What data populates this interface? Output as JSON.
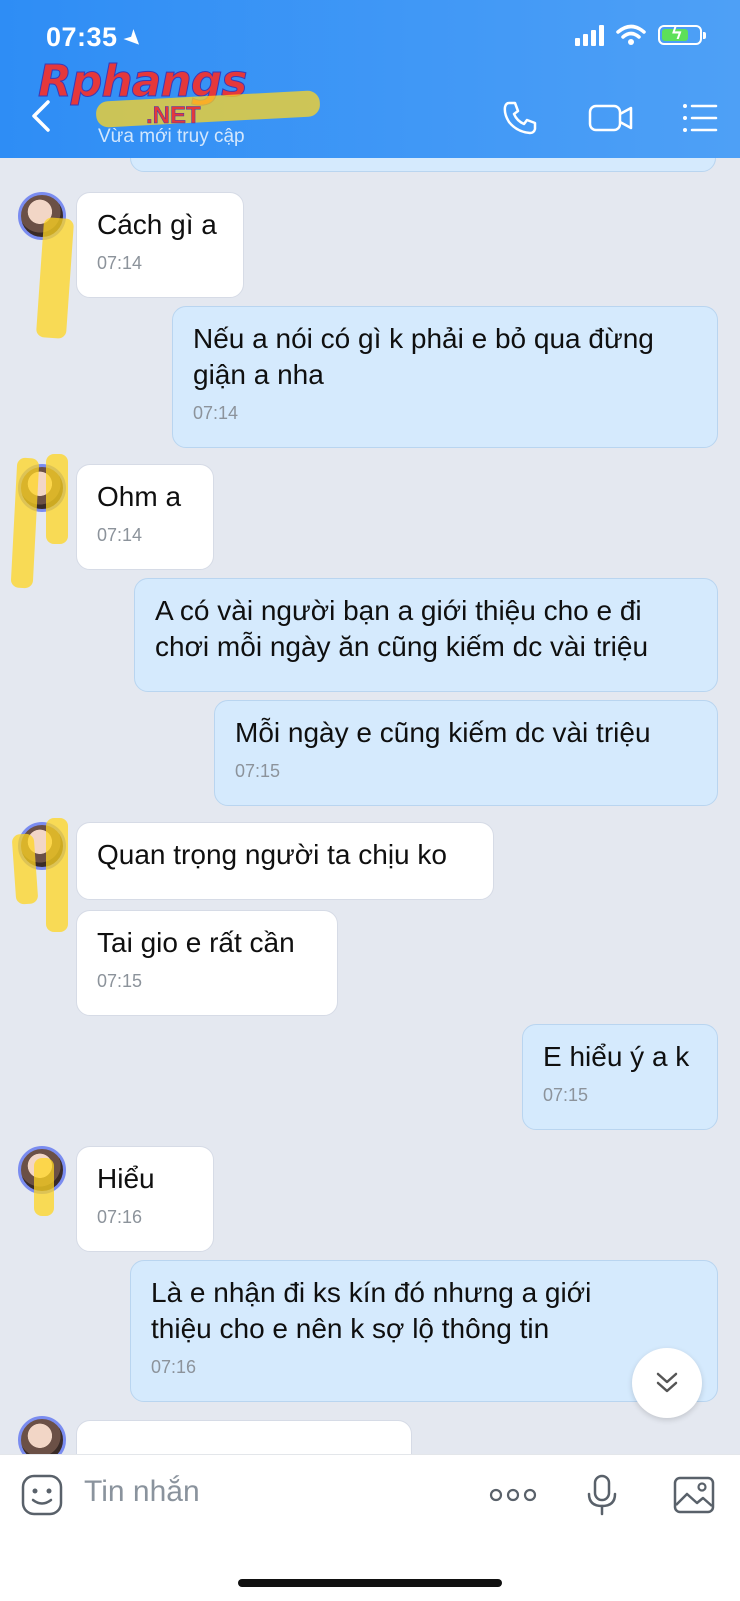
{
  "status_bar": {
    "time": "07:35"
  },
  "header": {
    "watermark_main": "Rphangs",
    "watermark_net": ".NET",
    "subtitle": "Vừa mới truy cập"
  },
  "messages": [
    {
      "dir": "in",
      "text": "Cách gì a",
      "time": "07:14"
    },
    {
      "dir": "out",
      "text": "Nếu a nói có gì k phải e bỏ qua đừng giận a nha",
      "time": "07:14"
    },
    {
      "dir": "in",
      "text": "Ohm a",
      "time": "07:14"
    },
    {
      "dir": "out",
      "text": "A có vài người bạn a giới thiệu cho e đi chơi mỗi ngày ăn cũng kiếm dc vài triệu",
      "time": ""
    },
    {
      "dir": "out",
      "text": "Mỗi ngày e cũng kiếm dc vài triệu",
      "time": "07:15"
    },
    {
      "dir": "in",
      "text": "Quan trọng người ta chịu ko",
      "time": ""
    },
    {
      "dir": "in",
      "text": "Tai gio e rất cần",
      "time": "07:15"
    },
    {
      "dir": "out",
      "text": "E hiểu ý a k",
      "time": "07:15"
    },
    {
      "dir": "in",
      "text": "Hiểu",
      "time": "07:16"
    },
    {
      "dir": "out",
      "text": "Là e nhận đi ks kín đó nhưng a giới thiệu cho e nên k sợ lộ thông tin",
      "time": "07:16"
    }
  ],
  "input": {
    "placeholder": "Tin nhắn"
  },
  "icons": {
    "back": "chevron-left-icon",
    "call": "phone-icon",
    "video": "video-camera-icon",
    "menu": "list-menu-icon",
    "sticker": "sticker-icon",
    "more": "more-dots-icon",
    "mic": "microphone-icon",
    "image": "image-icon",
    "scroll": "double-chevron-down-icon"
  },
  "colors": {
    "header": "#2e8df5",
    "outgoing_bubble": "#d5eafd",
    "incoming_bubble": "#ffffff",
    "background": "#e4e8f0"
  }
}
